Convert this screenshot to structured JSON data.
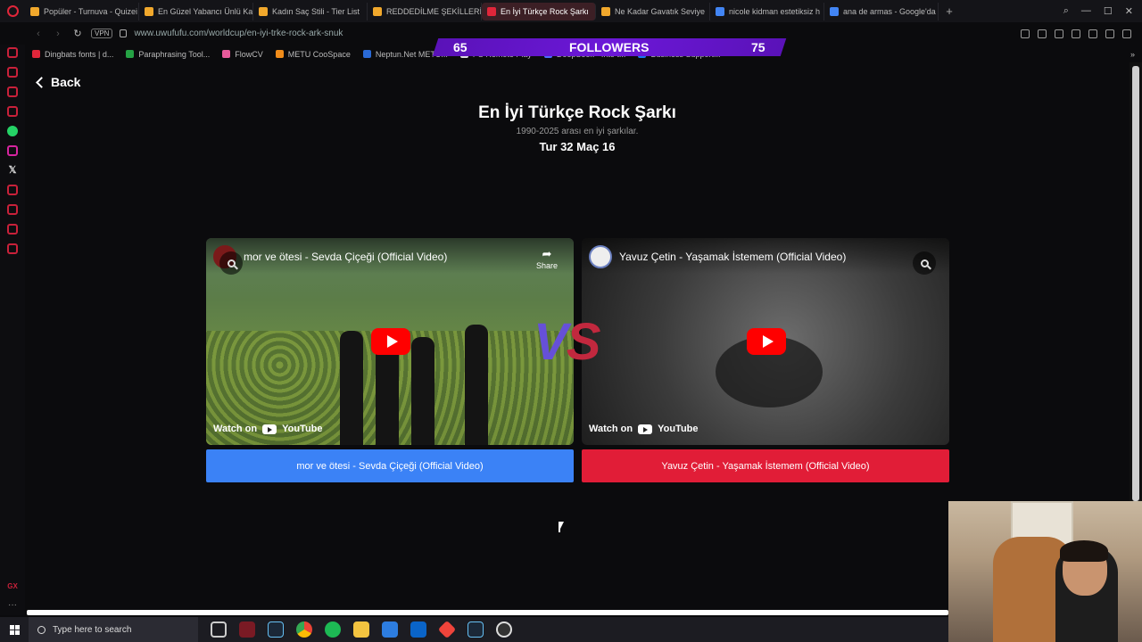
{
  "tabs": [
    {
      "label": "Popüler - Turnuva - Quizei",
      "color": "#f1a82c",
      "active": false
    },
    {
      "label": "En Güzel Yabancı Ünlü Ka",
      "color": "#f1a82c",
      "active": false
    },
    {
      "label": "Kadın Saç Stili - Tier List",
      "color": "#f1a82c",
      "active": false
    },
    {
      "label": "REDDEDİLME ŞEKİLLERİ",
      "color": "#f1a82c",
      "active": false
    },
    {
      "label": "En İyi Türkçe Rock Şarkı",
      "color": "#e0263a",
      "active": true
    },
    {
      "label": "Ne Kadar Gavatık Seviye",
      "color": "#f1a82c",
      "active": false
    },
    {
      "label": "nicole kidman estetiksiz h",
      "color": "#4285f4",
      "active": false
    },
    {
      "label": "ana de armas - Google'da",
      "color": "#4285f4",
      "active": false
    }
  ],
  "addressbar": {
    "vpn_label": "VPN",
    "url": "www.uwufufu.com/worldcup/en-iyi-trke-rock-ark-snuk"
  },
  "bookmarks": [
    {
      "label": "Dingbats fonts | d...",
      "color": "#e0263a"
    },
    {
      "label": "Paraphrasing Tool...",
      "color": "#25a244"
    },
    {
      "label": "FlowCV",
      "color": "#e85a9b"
    },
    {
      "label": "METU CooSpace",
      "color": "#f08c1a"
    },
    {
      "label": "Neptun.Net METU...",
      "color": "#2a6ad6"
    },
    {
      "label": "PS Remote Play",
      "color": "#dddddd"
    },
    {
      "label": "DeepSeek - Into t...",
      "color": "#4b6bff"
    },
    {
      "label": "Business Support...",
      "color": "#1877f2"
    }
  ],
  "followers": {
    "left_value": "65",
    "label": "FOLLOWERS",
    "right_value": "75"
  },
  "page": {
    "back_label": "Back",
    "title": "En İyi Türkçe Rock Şarkı",
    "subtitle": "1990-2025 arası en iyi şarkılar.",
    "round_label": "Tur 32 Maç 16",
    "vs_left": "V",
    "vs_right": "S"
  },
  "videos": {
    "left": {
      "title": "mor ve ötesi - Sevda Çiçeği (Official Video)",
      "share_label": "Share",
      "watch_label": "Watch on",
      "yt_label": "YouTube",
      "button_label": "mor ve ötesi - Sevda Çiçeği (Official Video)",
      "button_color": "#3b82f6"
    },
    "right": {
      "title": "Yavuz Çetin - Yaşamak İstemem (Official Video)",
      "watch_label": "Watch on",
      "yt_label": "YouTube",
      "button_label": "Yavuz Çetin - Yaşamak İstemem (Official Video)",
      "button_color": "#e11d37"
    }
  },
  "taskbar": {
    "search_placeholder": "Type here to search",
    "apps": [
      "task-view",
      "opera-gx",
      "steam",
      "chrome",
      "spotify",
      "file-explorer",
      "microsoft-store",
      "outlook",
      "anydesk",
      "steam-2",
      "obs"
    ]
  },
  "sidebar": {
    "gx_label": "GX",
    "more_label": "···",
    "x_label": "𝕏"
  },
  "window": {
    "add_tab": "+",
    "bookmarks_more": "»"
  }
}
